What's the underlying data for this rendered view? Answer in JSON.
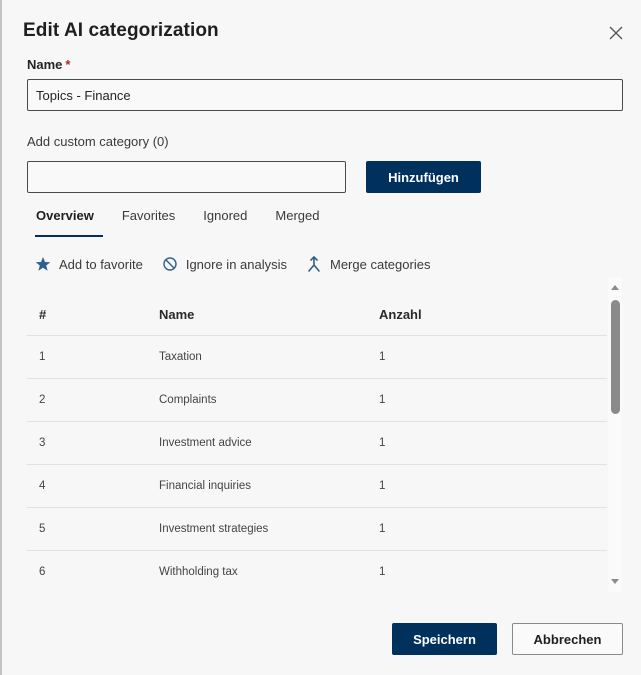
{
  "dialog": {
    "title": "Edit AI categorization",
    "close_icon": "close-icon"
  },
  "name_field": {
    "label": "Name",
    "required_marker": "*",
    "value": "Topics - Finance"
  },
  "custom_category": {
    "label": "Add custom category (0)",
    "value": "",
    "placeholder": "",
    "add_button": "Hinzufügen"
  },
  "tabs": [
    {
      "label": "Overview",
      "active": true
    },
    {
      "label": "Favorites",
      "active": false
    },
    {
      "label": "Ignored",
      "active": false
    },
    {
      "label": "Merged",
      "active": false
    }
  ],
  "toolbar": {
    "favorite": {
      "label": "Add to favorite",
      "icon": "star-icon"
    },
    "ignore": {
      "label": "Ignore in analysis",
      "icon": "prohibited-icon"
    },
    "merge": {
      "label": "Merge categories",
      "icon": "merge-icon"
    }
  },
  "table": {
    "columns": [
      "#",
      "Name",
      "Anzahl"
    ],
    "rows": [
      {
        "num": "1",
        "name": "Taxation",
        "count": "1"
      },
      {
        "num": "2",
        "name": "Complaints",
        "count": "1"
      },
      {
        "num": "3",
        "name": "Investment advice",
        "count": "1"
      },
      {
        "num": "4",
        "name": "Financial inquiries",
        "count": "1"
      },
      {
        "num": "5",
        "name": "Investment strategies",
        "count": "1"
      },
      {
        "num": "6",
        "name": "Withholding tax",
        "count": "1"
      }
    ]
  },
  "footer": {
    "save": "Speichern",
    "cancel": "Abbrechen"
  },
  "colors": {
    "primary": "#00315d",
    "required": "#b3262e",
    "icon_blue": "#2f5f8f"
  }
}
